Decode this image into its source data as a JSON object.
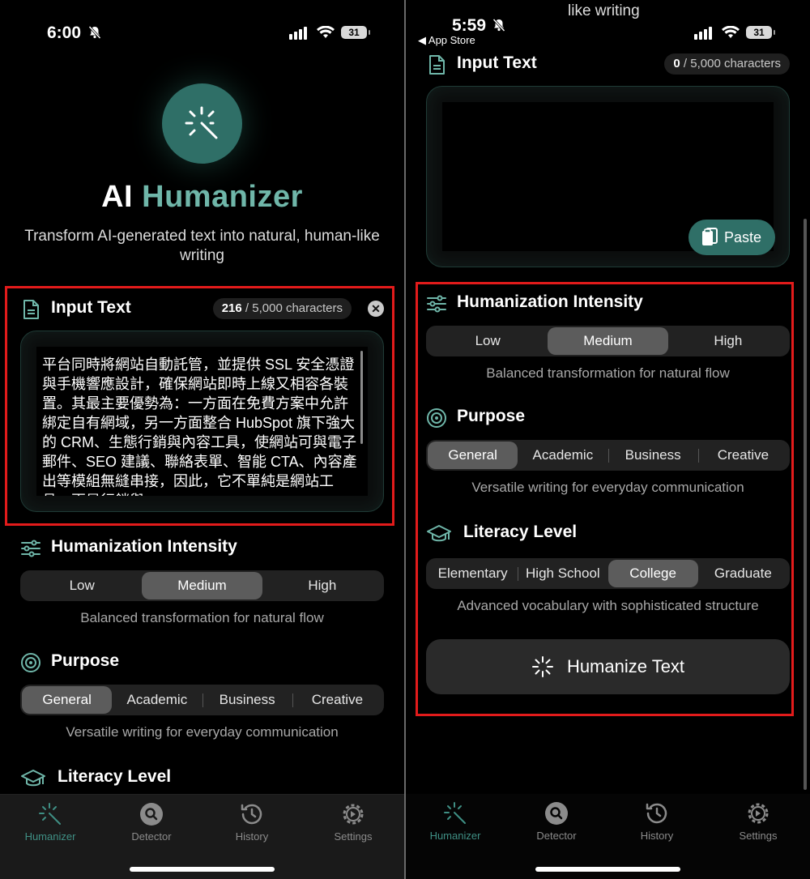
{
  "status_left": {
    "time": "6:00",
    "battery": "31"
  },
  "status_right": {
    "time": "5:59",
    "battery": "31",
    "back_label": "◀ App Store"
  },
  "right_top_text": "like writing",
  "app": {
    "title_ai": "AI",
    "title_humanizer": "Humanizer",
    "subtitle": "Transform AI-generated text into natural, human-like writing"
  },
  "input_left": {
    "label": "Input Text",
    "count": "216",
    "limit": "/ 5,000 characters",
    "text": "平台同時將網站自動託管，並提供 SSL 安全憑證與手機響應設計，確保網站即時上線又相容各裝置。其最主要優勢為：一方面在免費方案中允許綁定自有網域，另一方面整合 HubSpot 旗下強大的 CRM、生態行銷與內容工具，使網站可與電子郵件、SEO 建議、聯絡表單、智能 CTA、內容產出等模組無縫串接，因此，它不單純是網站工具，更是行銷與"
  },
  "input_right": {
    "label": "Input Text",
    "count": "0",
    "limit": "/ 5,000 characters",
    "paste_label": "Paste"
  },
  "intensity": {
    "label": "Humanization Intensity",
    "options": [
      "Low",
      "Medium",
      "High"
    ],
    "selected": "Medium",
    "description": "Balanced transformation for natural flow"
  },
  "purpose": {
    "label": "Purpose",
    "options": [
      "General",
      "Academic",
      "Business",
      "Creative"
    ],
    "selected": "General",
    "description": "Versatile writing for everyday communication"
  },
  "literacy": {
    "label": "Literacy Level",
    "options": [
      "Elementary",
      "High School",
      "College",
      "Graduate"
    ],
    "selected": "College",
    "description": "Advanced vocabulary with sophisticated structure"
  },
  "humanize_button": "Humanize Text",
  "tabs": [
    "Humanizer",
    "Detector",
    "History",
    "Settings"
  ],
  "colors": {
    "accent": "#2f6f67",
    "accent_text": "#6fb6a9",
    "highlight": "#e21b1b",
    "active_tab": "#3f8f84"
  }
}
